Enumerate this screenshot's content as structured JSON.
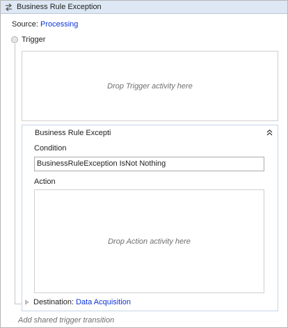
{
  "header": {
    "title": "Business Rule Exception",
    "icon": "transition-icon"
  },
  "source": {
    "label": "Source:",
    "value": "Processing"
  },
  "trigger": {
    "label": "Trigger",
    "placeholder": "Drop Trigger activity here"
  },
  "transition": {
    "title": "Business Rule Exception",
    "condition_label": "Condition",
    "condition_value": "BusinessRuleException IsNot Nothing",
    "action_label": "Action",
    "action_placeholder": "Drop Action activity here",
    "destination_label": "Destination:",
    "destination_value": "Data Acquisition"
  },
  "footer": {
    "add_shared": "Add shared trigger transition"
  },
  "colors": {
    "header_bg": "#dde8f4",
    "link": "#0b33d9",
    "placeholder": "#6f6f6f"
  }
}
